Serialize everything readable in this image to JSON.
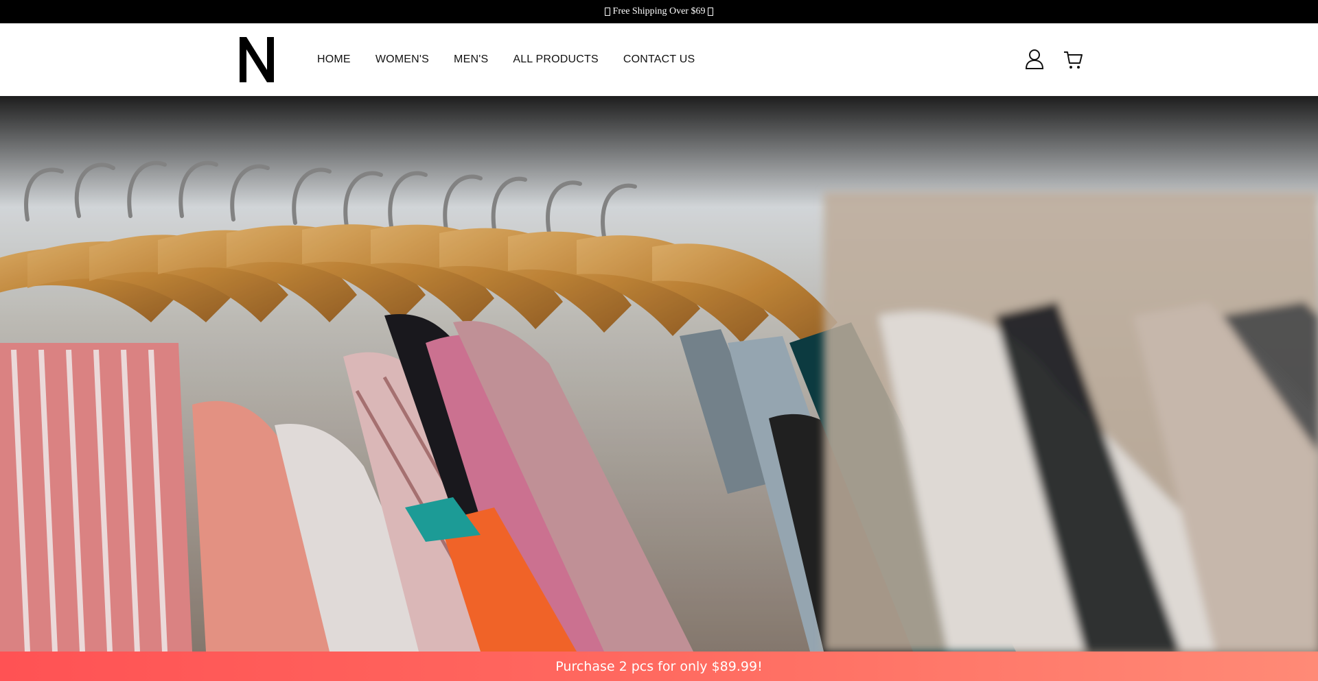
{
  "announcement": {
    "text": "Free Shipping Over $69"
  },
  "header": {
    "logo_letter": "N",
    "nav": [
      {
        "label": "HOME"
      },
      {
        "label": "WOMEN'S"
      },
      {
        "label": "MEN'S"
      },
      {
        "label": "ALL PRODUCTS"
      },
      {
        "label": "CONTACT US"
      }
    ],
    "icons": [
      "user-icon",
      "cart-icon"
    ]
  },
  "hero": {
    "image": "clothes-on-hangers-photo"
  },
  "promo": {
    "text": "Purchase 2 pcs for only $89.99!"
  },
  "colors": {
    "announcement_bg": "#000000",
    "promo_start": "#ff5254",
    "promo_end": "#ff8a76"
  }
}
